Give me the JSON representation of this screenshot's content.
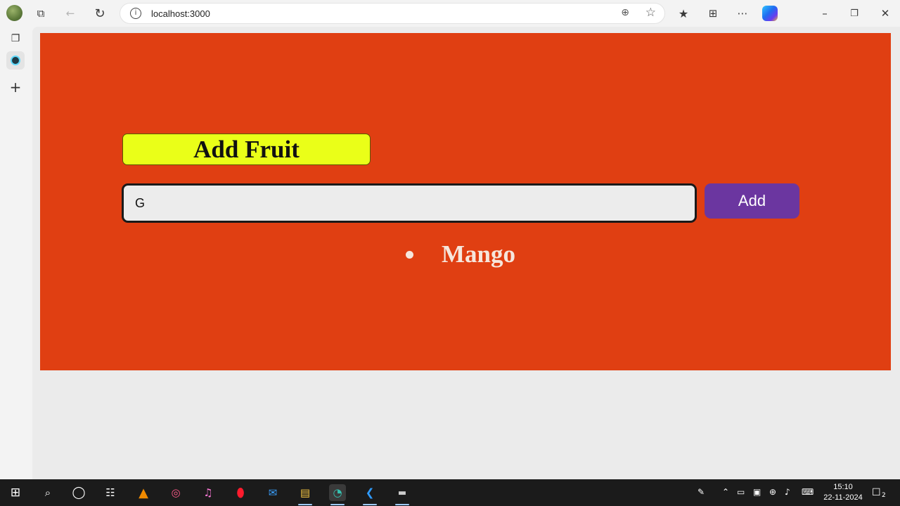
{
  "browser": {
    "url": "localhost:3000"
  },
  "app": {
    "heading": "Add Fruit",
    "input": {
      "value": "G",
      "placeholder": ""
    },
    "add_button_label": "Add",
    "fruits": [
      "Mango"
    ]
  },
  "colors": {
    "panel_background": "#e03f12",
    "heading_background": "#eaff18",
    "add_button": "#6b36a0"
  },
  "taskbar": {
    "time": "15:10",
    "date": "22-11-2024",
    "notification_count": "2"
  }
}
